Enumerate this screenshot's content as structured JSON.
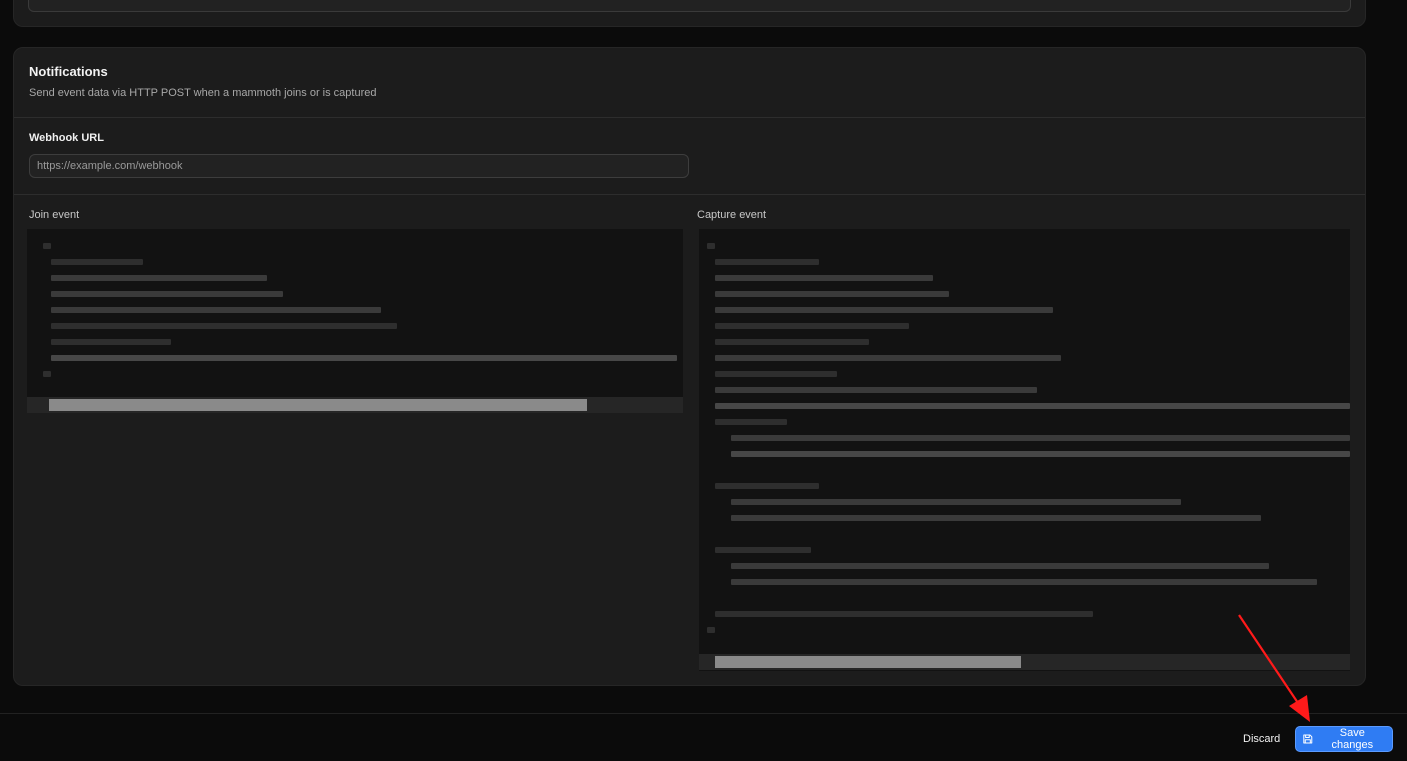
{
  "notifications": {
    "title": "Notifications",
    "description": "Send event data via HTTP POST when a mammoth joins or is captured"
  },
  "webhook": {
    "label": "Webhook URL",
    "placeholder": "https://example.com/webhook",
    "value": ""
  },
  "join_event": {
    "label": "Join event"
  },
  "capture_event": {
    "label": "Capture event"
  },
  "footer": {
    "discard_label": "Discard",
    "save_label": "Save changes"
  },
  "colors": {
    "accent": "#2f7cf3",
    "annotation_arrow": "#ff1a1a"
  },
  "icons": {
    "save": "save-icon"
  }
}
